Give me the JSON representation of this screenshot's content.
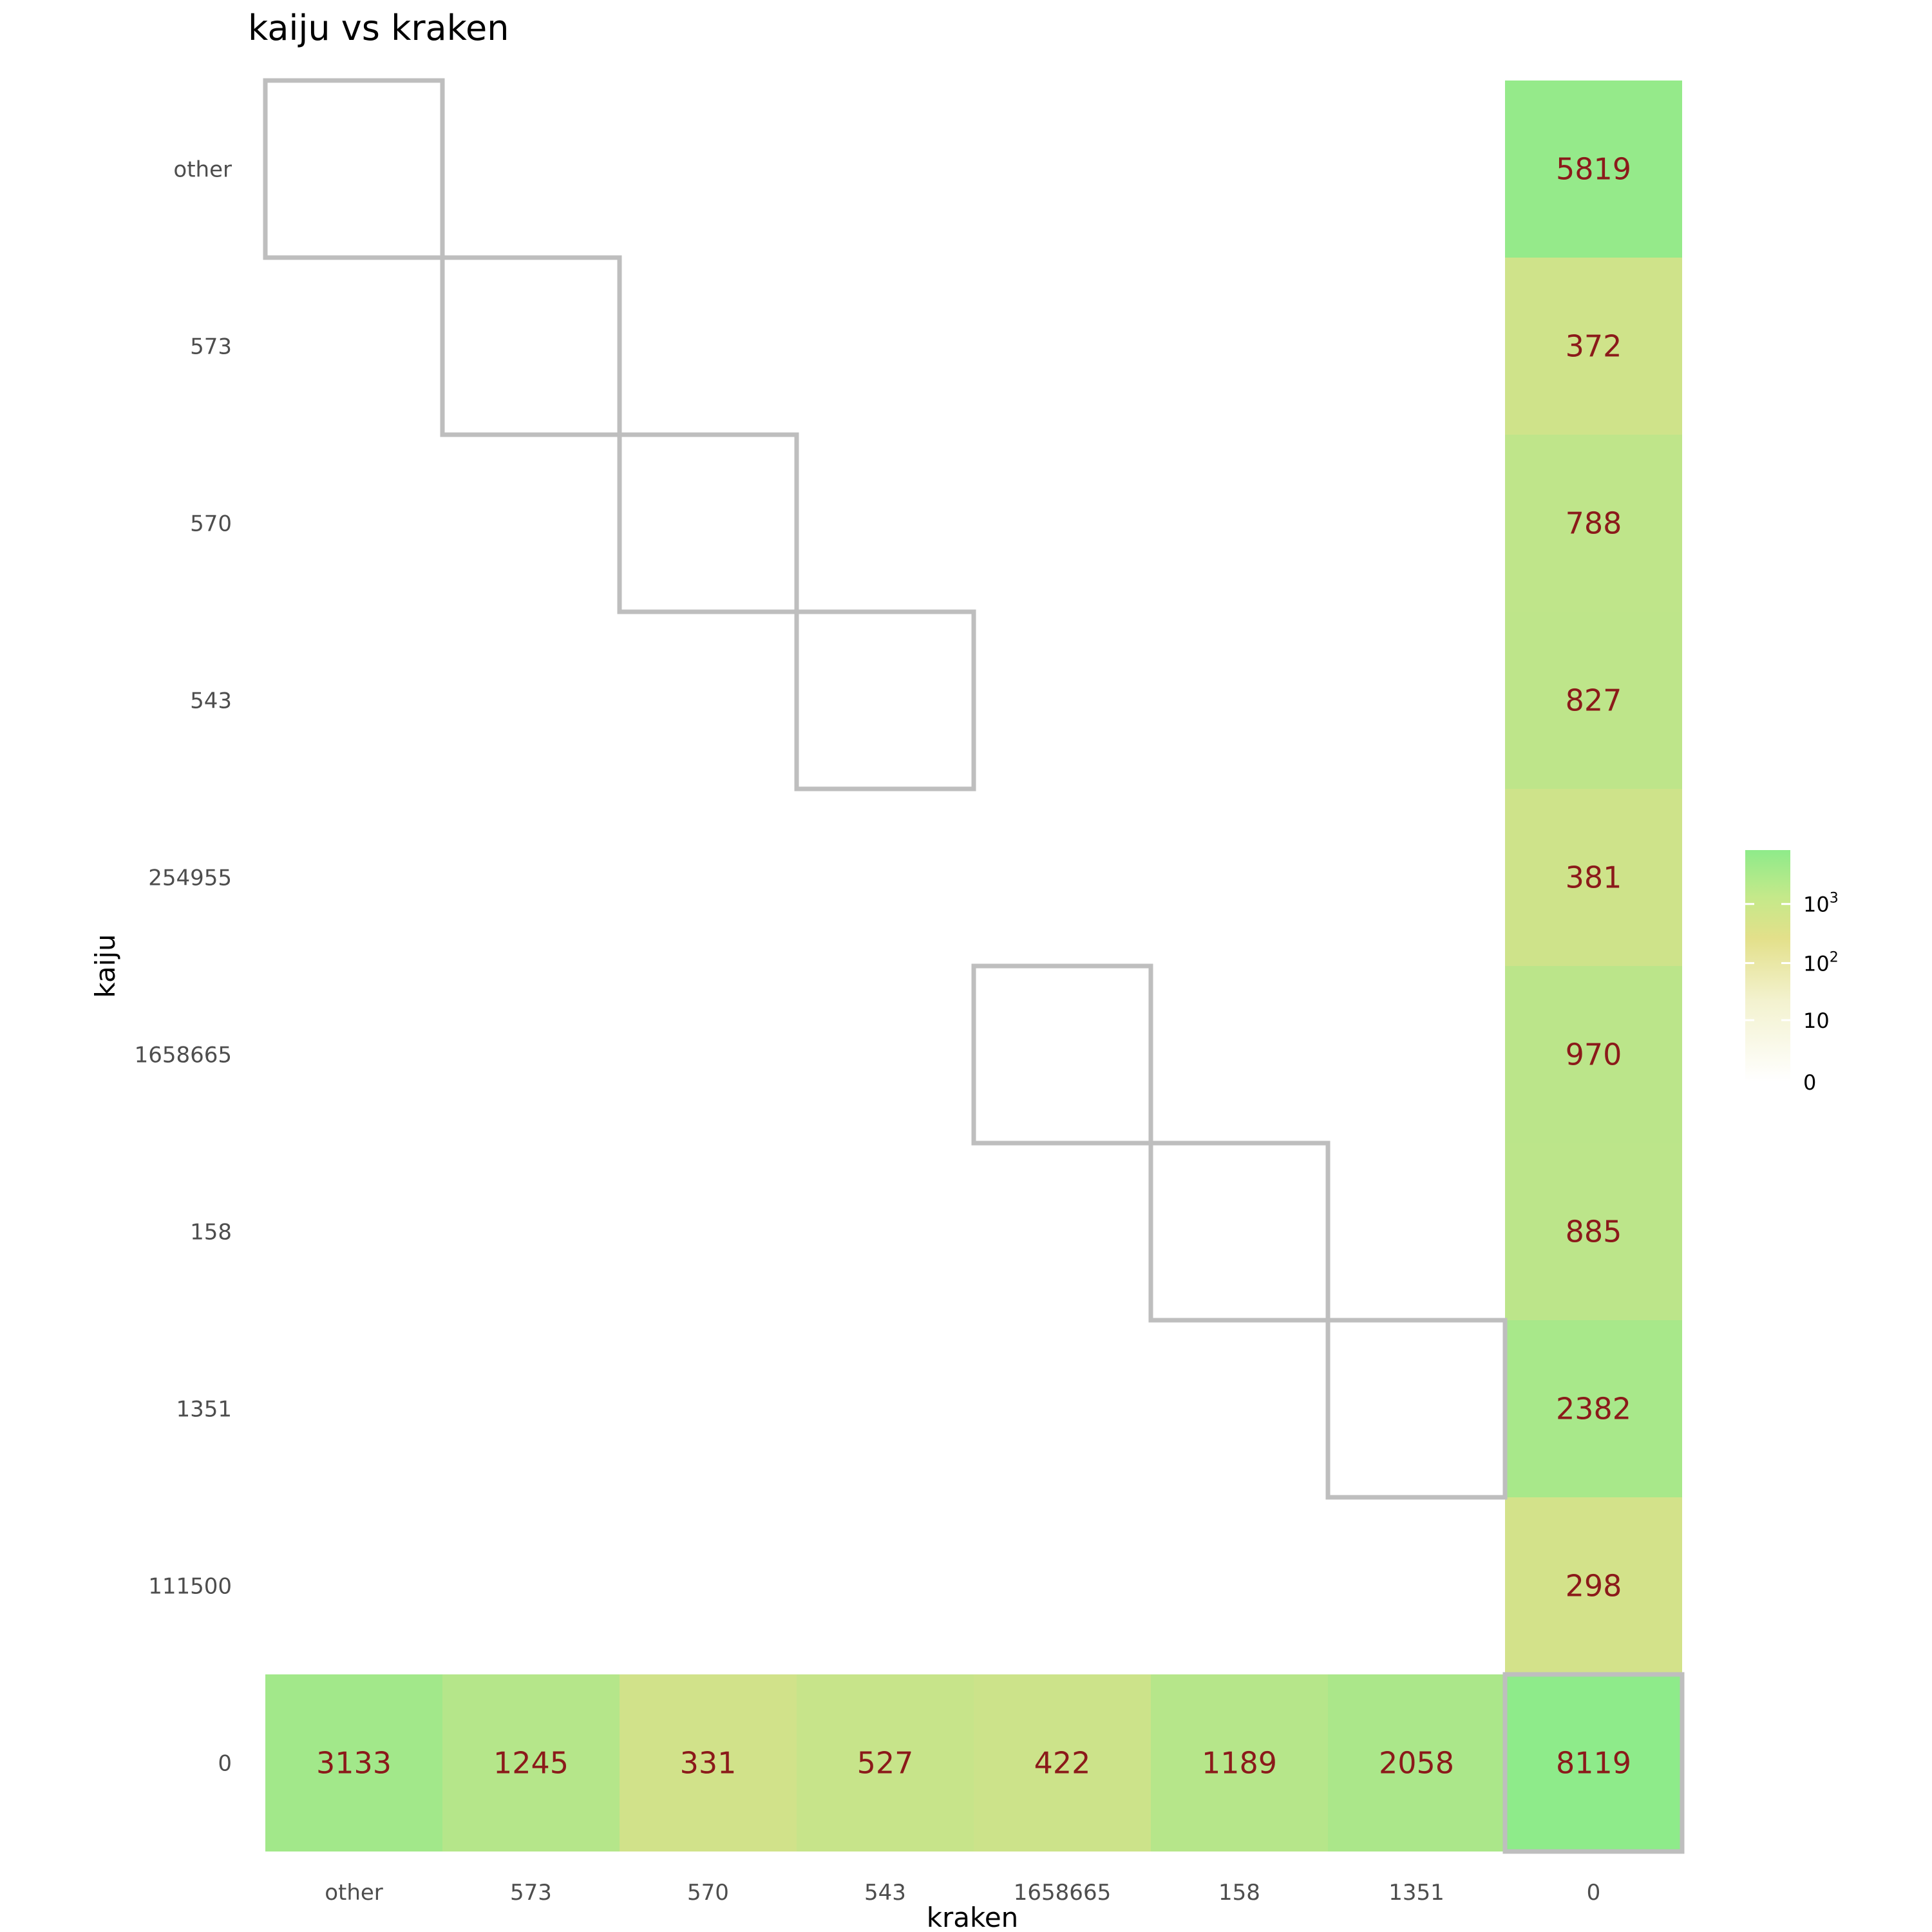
{
  "chart_data": {
    "type": "heatmap",
    "title": "kaiju vs kraken",
    "xlabel": "kraken",
    "ylabel": "kaiju",
    "x_categories": [
      "other",
      "573",
      "570",
      "543",
      "1658665",
      "158",
      "1351",
      "0"
    ],
    "y_categories": [
      "other",
      "573",
      "570",
      "543",
      "254955",
      "1658665",
      "158",
      "1351",
      "111500",
      "0"
    ],
    "cells": [
      {
        "x": "0",
        "y": "other",
        "value": 5819
      },
      {
        "x": "0",
        "y": "573",
        "value": 372
      },
      {
        "x": "0",
        "y": "570",
        "value": 788
      },
      {
        "x": "0",
        "y": "543",
        "value": 827
      },
      {
        "x": "0",
        "y": "254955",
        "value": 381
      },
      {
        "x": "0",
        "y": "1658665",
        "value": 970
      },
      {
        "x": "0",
        "y": "158",
        "value": 885
      },
      {
        "x": "0",
        "y": "1351",
        "value": 2382
      },
      {
        "x": "0",
        "y": "111500",
        "value": 298
      },
      {
        "x": "other",
        "y": "0",
        "value": 3133
      },
      {
        "x": "573",
        "y": "0",
        "value": 1245
      },
      {
        "x": "570",
        "y": "0",
        "value": 331
      },
      {
        "x": "543",
        "y": "0",
        "value": 527
      },
      {
        "x": "1658665",
        "y": "0",
        "value": 422
      },
      {
        "x": "158",
        "y": "0",
        "value": 1189
      },
      {
        "x": "1351",
        "y": "0",
        "value": 2058
      },
      {
        "x": "0",
        "y": "0",
        "value": 8119
      }
    ],
    "diagonal_outlined": [
      {
        "x": "other",
        "y": "other"
      },
      {
        "x": "573",
        "y": "573"
      },
      {
        "x": "570",
        "y": "570"
      },
      {
        "x": "543",
        "y": "543"
      },
      {
        "x": "1658665",
        "y": "1658665"
      },
      {
        "x": "158",
        "y": "158"
      },
      {
        "x": "1351",
        "y": "1351"
      },
      {
        "x": "0",
        "y": "0"
      }
    ],
    "color_scale": {
      "type": "log",
      "colors": [
        "#ffffff",
        "#e3e08a",
        "#8eeb8a"
      ],
      "legend_ticks": [
        "0",
        "10",
        "10^2",
        "10^3"
      ],
      "legend_placement": "right"
    },
    "grid": false
  }
}
